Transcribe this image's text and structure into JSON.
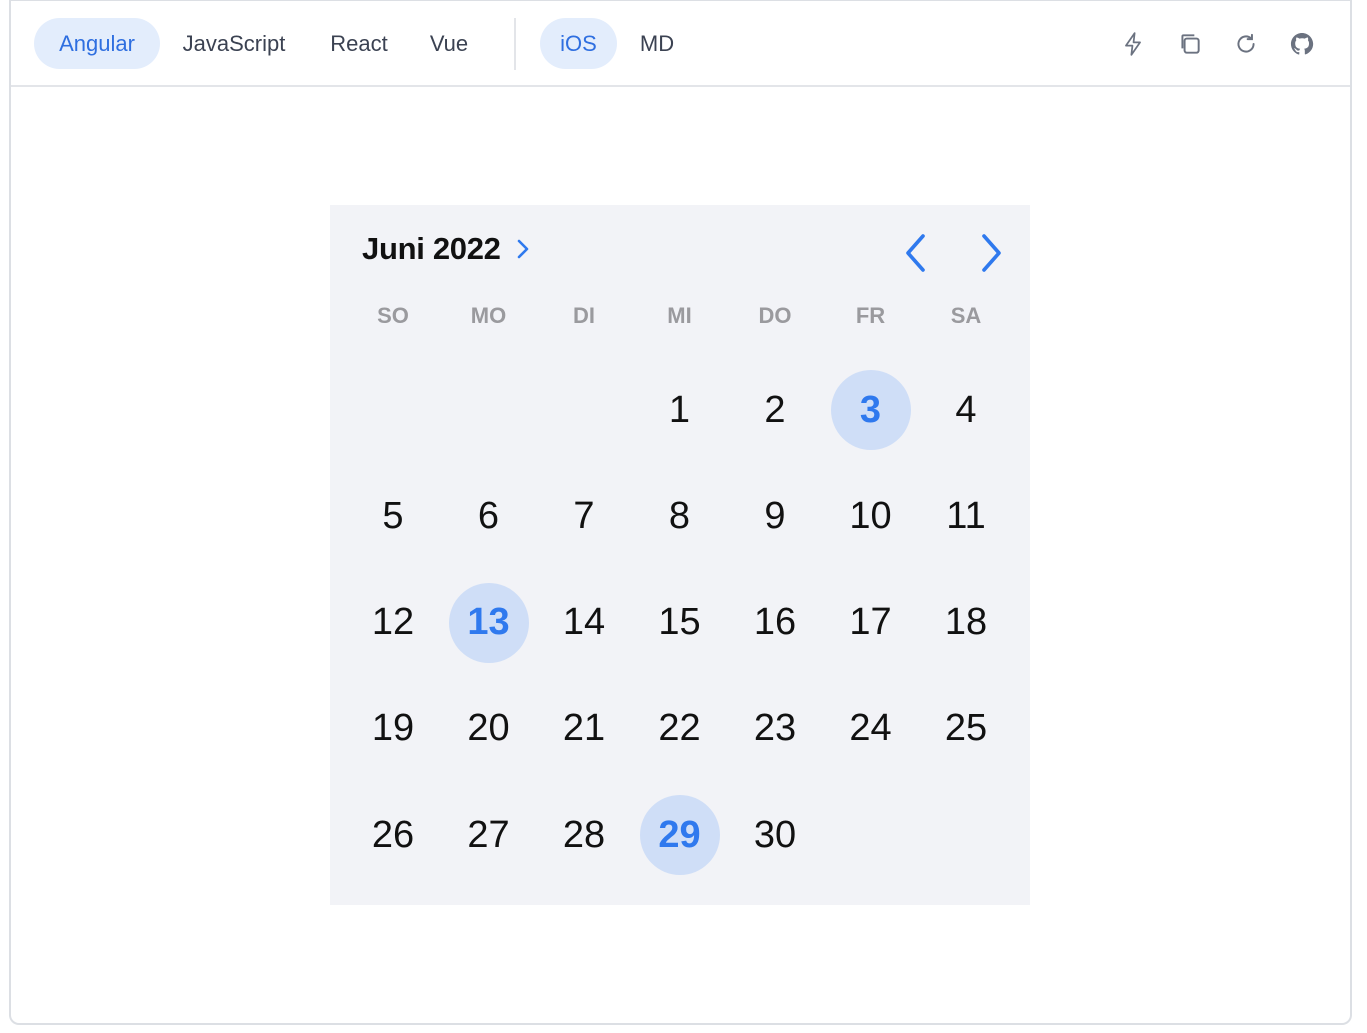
{
  "toolbar": {
    "framework_tabs": [
      {
        "label": "Angular",
        "active": true
      },
      {
        "label": "JavaScript",
        "active": false
      },
      {
        "label": "React",
        "active": false
      },
      {
        "label": "Vue",
        "active": false
      }
    ],
    "mode_tabs": [
      {
        "label": "iOS",
        "active": true
      },
      {
        "label": "MD",
        "active": false
      }
    ],
    "icons": [
      "lightning-icon",
      "copy-icon",
      "refresh-icon",
      "github-icon"
    ]
  },
  "calendar": {
    "month_label": "Juni 2022",
    "weekdays": [
      "SO",
      "MO",
      "DI",
      "MI",
      "DO",
      "FR",
      "SA"
    ],
    "first_weekday_index": 3,
    "days_in_month": 30,
    "highlighted_days": [
      3,
      13,
      29
    ],
    "accent_color": "#2f79ee",
    "highlight_bg": "#cfdef7"
  }
}
